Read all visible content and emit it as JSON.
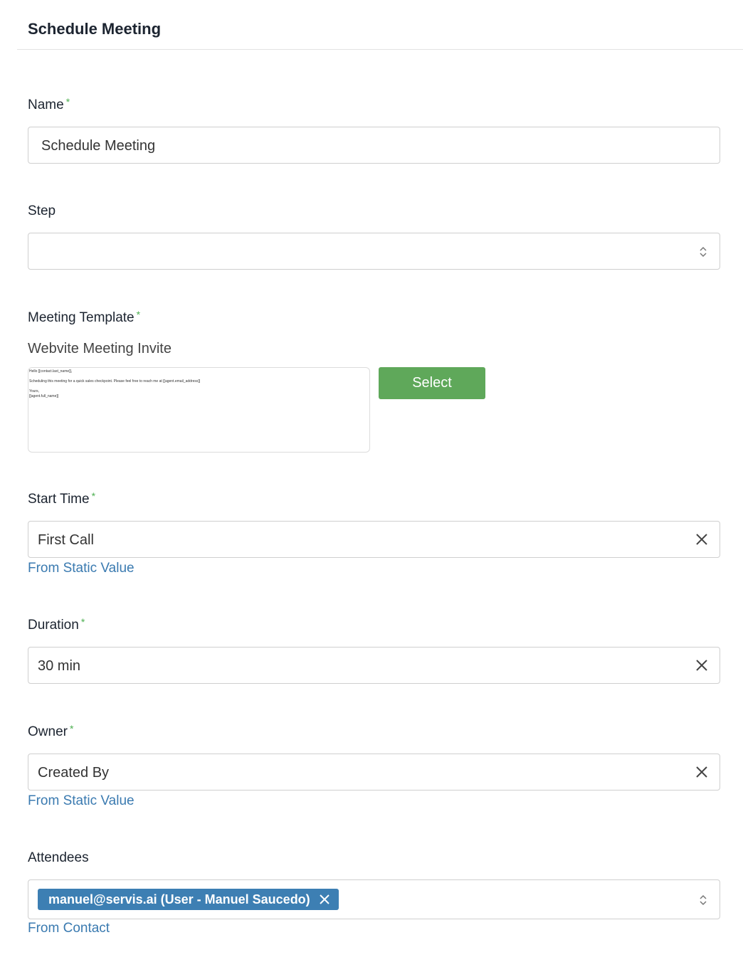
{
  "header": {
    "title": "Schedule Meeting"
  },
  "required_mark": "*",
  "name": {
    "label": "Name",
    "value": "Schedule Meeting"
  },
  "step": {
    "label": "Step",
    "value": ""
  },
  "meeting_template": {
    "label": "Meeting Template",
    "template_name": "Webvite Meeting Invite",
    "preview_lines": [
      "Hello [[contact.last_name]],",
      "",
      "Scheduling this meeting for a quick sales checkpoint. Please feel free to reach me at [[agent.email_address]]",
      "",
      "Yours,",
      "[[agent.full_name]]"
    ],
    "select_label": "Select"
  },
  "start_time": {
    "label": "Start Time",
    "value": "First Call",
    "link": "From Static Value"
  },
  "duration": {
    "label": "Duration",
    "value": "30 min"
  },
  "owner": {
    "label": "Owner",
    "value": "Created By",
    "link": "From Static Value"
  },
  "attendees": {
    "label": "Attendees",
    "chips": [
      "manuel@servis.ai (User - Manuel Saucedo)"
    ],
    "link": "From Contact"
  },
  "colors": {
    "required": "#4caf50",
    "link": "#3a7ab0",
    "select_button": "#5fa85a",
    "chip": "#3d7fb3"
  }
}
